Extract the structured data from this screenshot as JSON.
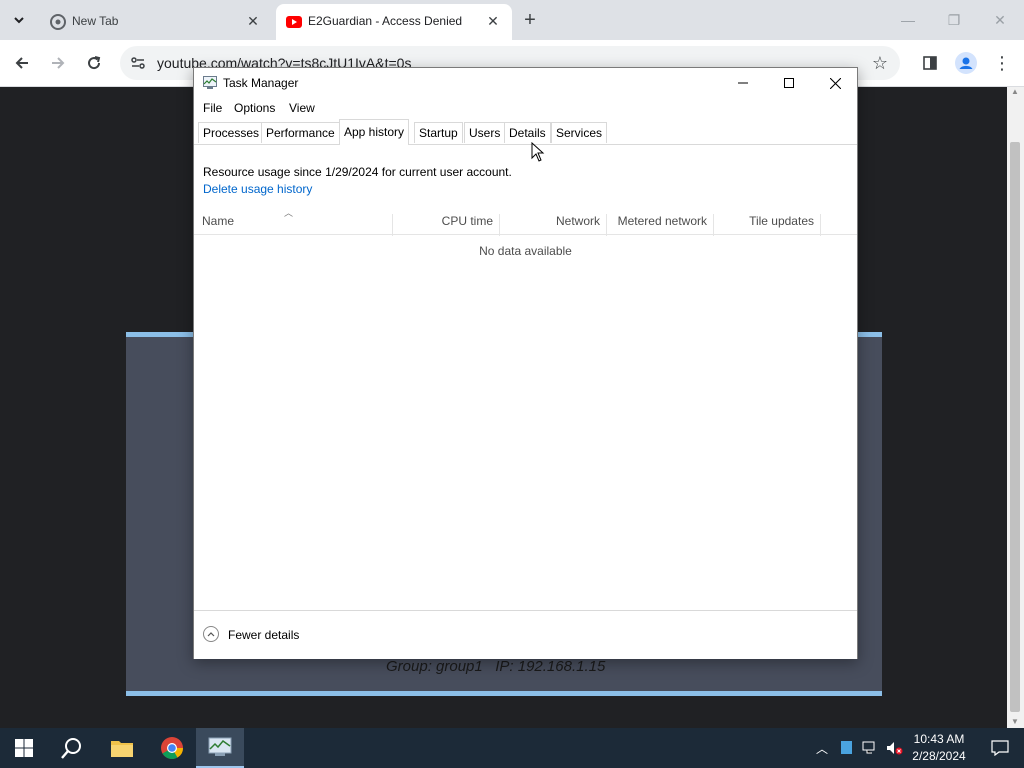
{
  "browser": {
    "tabs": [
      {
        "title": "New Tab",
        "favicon": "chrome-icon",
        "active": false
      },
      {
        "title": "E2Guardian - Access Denied",
        "favicon": "youtube-icon",
        "active": true
      }
    ],
    "address": "youtube.com/watch?v=ts8cJtU1IvA&t=0s"
  },
  "page": {
    "group_line": "Group: group1   IP: 192.168.1.15"
  },
  "task_manager": {
    "title": "Task Manager",
    "menu": [
      "File",
      "Options",
      "View"
    ],
    "tabs": [
      "Processes",
      "Performance",
      "App history",
      "Startup",
      "Users",
      "Details",
      "Services"
    ],
    "selected_tab": "App history",
    "info": "Resource usage since 1/29/2024 for current user account.",
    "delete_link": "Delete usage history",
    "columns": [
      "Name",
      "CPU time",
      "Network",
      "Metered network",
      "Tile updates"
    ],
    "empty_message": "No data available",
    "footer": "Fewer details"
  },
  "taskbar": {
    "time": "10:43 AM",
    "date": "2/28/2024"
  },
  "colors": {
    "accent_link": "#0066cc",
    "taskbar_bg": "#1c2a38",
    "page_bg": "#202124",
    "block_box": "#474d5c",
    "block_border": "#8cbfe8"
  }
}
